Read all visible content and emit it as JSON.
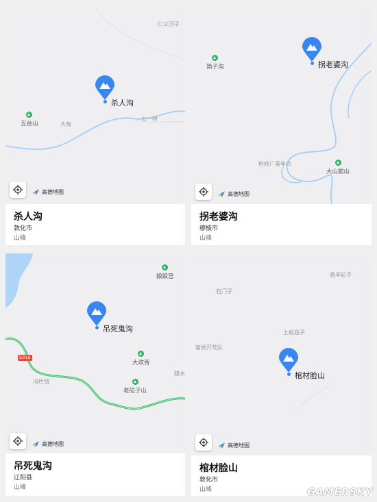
{
  "cards": [
    {
      "name": "杀人沟",
      "city": "敦化市",
      "category": "山峰",
      "map_labels": [
        "仁义河子",
        "大甸",
        "七一桥"
      ],
      "pois": [
        "五台山"
      ]
    },
    {
      "name": "拐老婆沟",
      "city": "穆棱市",
      "category": "山峰",
      "map_labels": [
        "检修厂青年点"
      ],
      "pois": [
        "简子沟",
        "大山前山"
      ]
    },
    {
      "name": "吊死鬼沟",
      "city": "辽阳县",
      "category": "山峰",
      "map_labels": [
        "河栏镇",
        "甜水"
      ],
      "road_badge": "S316",
      "pois": [
        "娘娘宫",
        "大欢背",
        "老砬子山"
      ]
    },
    {
      "name": "棺材脸山",
      "city": "敦化市",
      "category": "山峰",
      "map_labels": [
        "悬羊砬子",
        "石门子",
        "上板庙子",
        "富贵开荒队"
      ],
      "pois": []
    }
  ],
  "map_logo_text": "高德地图",
  "watermark": "GAMERSKY",
  "icons": {
    "pin": "mountain-pin-icon",
    "locate": "locate-icon",
    "logo": "amap-logo-icon",
    "poi": "mountain-poi-icon"
  },
  "colors": {
    "pin": "#3a86f0",
    "poi": "#2fb36a",
    "river": "#9ec9f5",
    "road": "#3dbf6a",
    "map_bg": "#efeff1"
  }
}
